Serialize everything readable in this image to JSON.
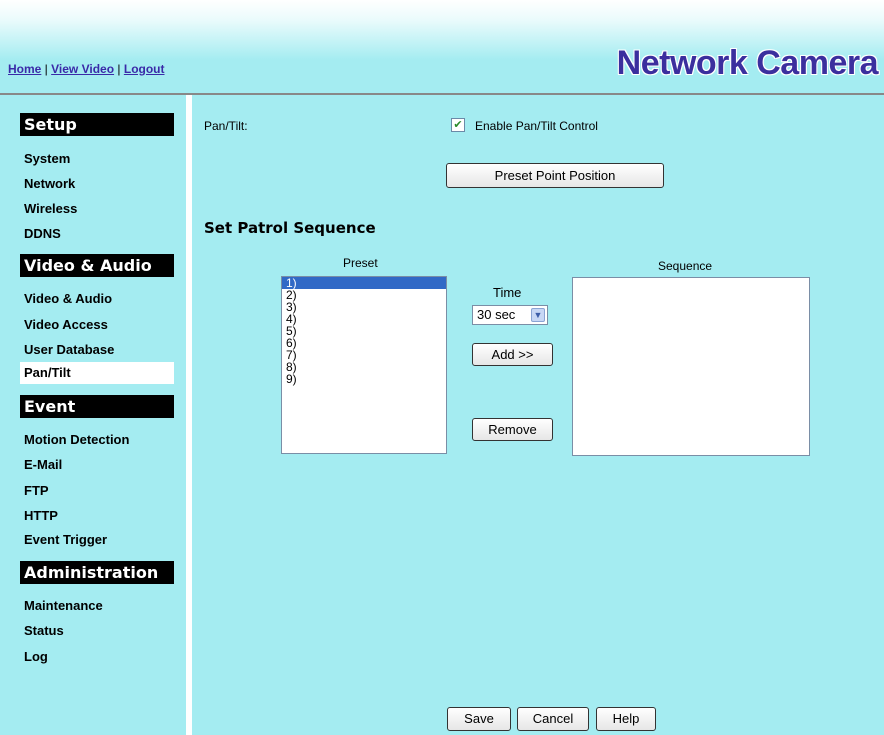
{
  "header": {
    "links": [
      "Home",
      "View Video",
      "Logout"
    ],
    "separator": " | ",
    "logo": "Network Camera"
  },
  "sidebar": {
    "sections": [
      {
        "title": "Setup",
        "items": [
          "System",
          "Network",
          "Wireless",
          "DDNS"
        ]
      },
      {
        "title": "Video & Audio",
        "items": [
          "Video & Audio",
          "Video Access",
          "User Database",
          "Pan/Tilt"
        ]
      },
      {
        "title": "Event",
        "items": [
          "Motion Detection",
          "E-Mail",
          "FTP",
          "HTTP",
          "Event Trigger"
        ]
      },
      {
        "title": "Administration",
        "items": [
          "Maintenance",
          "Status",
          "Log"
        ]
      }
    ],
    "active_item": "Pan/Tilt"
  },
  "main": {
    "pantilt_label": "Pan/Tilt:",
    "enable_label": "Enable Pan/Tilt Control",
    "enable_checked": true,
    "preset_button": "Preset Point Position",
    "patrol_heading": "Set Patrol Sequence",
    "preset_label": "Preset",
    "preset_options": [
      "1)",
      "2)",
      "3)",
      "4)",
      "5)",
      "6)",
      "7)",
      "8)",
      "9)"
    ],
    "preset_selected": "1)",
    "time_label": "Time",
    "time_value": "30 sec",
    "add_button": "Add >>",
    "remove_button": "Remove",
    "sequence_label": "Sequence"
  },
  "footer": {
    "save": "Save",
    "cancel": "Cancel",
    "help": "Help"
  },
  "icons": {
    "check": "check-icon",
    "dropdown": "chevron-down-icon"
  },
  "colors": {
    "background": "#a4ecf1",
    "link": "#3a2aa8",
    "logo": "#3b2f9e",
    "selection": "#3169c6"
  }
}
